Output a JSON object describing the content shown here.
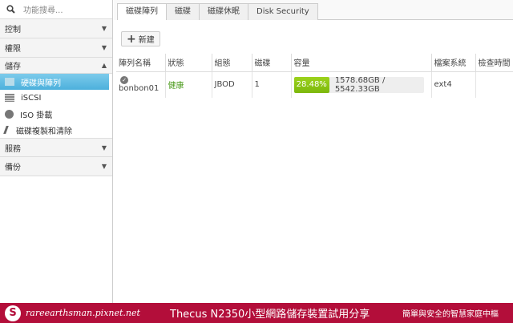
{
  "sidebar": {
    "search_placeholder": "功能搜尋...",
    "sections": [
      {
        "label": "控制",
        "expanded": false
      },
      {
        "label": "權限",
        "expanded": false
      },
      {
        "label": "儲存",
        "expanded": true
      },
      {
        "label": "服務",
        "expanded": false
      },
      {
        "label": "備份",
        "expanded": false
      }
    ],
    "storage_items": [
      {
        "label": "硬碟與陣列",
        "icon": "raid-icon",
        "selected": true
      },
      {
        "label": "iSCSI",
        "icon": "iscsi-icon"
      },
      {
        "label": "ISO 掛載",
        "icon": "disc-icon"
      },
      {
        "label": "磁碟複製和清除",
        "icon": "broom-icon"
      }
    ]
  },
  "tabs": [
    {
      "label": "磁碟陣列",
      "active": true
    },
    {
      "label": "磁碟"
    },
    {
      "label": "磁碟休眠"
    },
    {
      "label": "Disk Security"
    }
  ],
  "toolbar": {
    "new_label": "新建"
  },
  "table": {
    "headers": [
      "陣列名稱",
      "狀態",
      "組態",
      "磁碟",
      "容量",
      "檔案系統",
      "檢查時間"
    ],
    "rows": [
      {
        "name": "bonbon01",
        "status": "健康",
        "config": "JBOD",
        "disks": "1",
        "usage_percent": "28.48%",
        "usage_fraction": 0.2848,
        "capacity": "1578.68GB / 5542.33GB",
        "fs": "ext4",
        "check_time": ""
      }
    ]
  },
  "footer": {
    "site": "rareearthsman.pixnet.net",
    "title": "Thecus N2350小型網路儲存裝置試用分享",
    "slogan": "簡單與安全的智慧家庭中樞",
    "color": "#b30e3a"
  }
}
